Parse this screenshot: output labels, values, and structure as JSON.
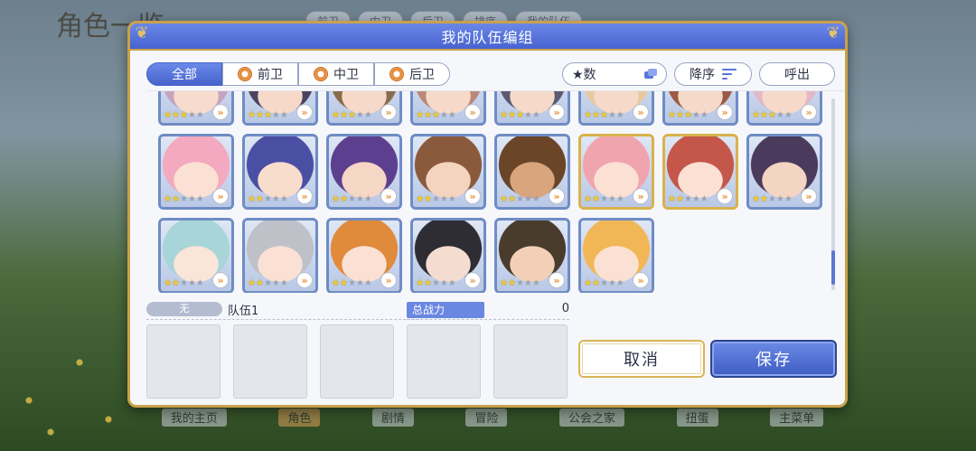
{
  "background": {
    "screen_title": "角色一览",
    "tabs": [
      "前卫",
      "中卫",
      "后卫",
      "排序",
      "我的队伍"
    ],
    "bottom_nav": [
      {
        "label": "我的主页",
        "active": false
      },
      {
        "label": "角色",
        "active": true
      },
      {
        "label": "剧情",
        "active": false
      },
      {
        "label": "冒险",
        "active": false
      },
      {
        "label": "公会之家",
        "active": false
      },
      {
        "label": "扭蛋",
        "active": false
      },
      {
        "label": "主菜单",
        "active": false
      }
    ]
  },
  "dialog": {
    "title": "我的队伍编组"
  },
  "filters": {
    "all": "全部",
    "front": "前卫",
    "middle": "中卫",
    "back": "后卫",
    "active": "全部"
  },
  "sort": {
    "key_label": "★数",
    "order_label": "降序",
    "call_out_label": "呼出"
  },
  "party": {
    "tag": "无",
    "name": "队伍1",
    "power_label": "总战力",
    "power_value": "0",
    "slots": 5
  },
  "buttons": {
    "cancel": "取消",
    "save": "保存"
  },
  "roster": [
    {
      "stars": 3,
      "badge": "»",
      "frame": "blue",
      "hair": "#c7a3bd",
      "skin": "#f7dccd"
    },
    {
      "stars": 3,
      "badge": "»",
      "frame": "blue",
      "hair": "#4a4461",
      "skin": "#f6d9c8"
    },
    {
      "stars": 3,
      "badge": "»",
      "frame": "blue",
      "hair": "#8a6b4a",
      "skin": "#f6d9c8"
    },
    {
      "stars": 3,
      "badge": "»",
      "frame": "blue",
      "hair": "#b98978",
      "skin": "#f6d9c8"
    },
    {
      "stars": 3,
      "badge": "»",
      "frame": "blue",
      "hair": "#5c5a72",
      "skin": "#f6d9c8"
    },
    {
      "stars": 3,
      "badge": "»",
      "frame": "blue",
      "hair": "#e7c9a1",
      "skin": "#f6d9c8"
    },
    {
      "stars": 3,
      "badge": "»",
      "frame": "blue",
      "hair": "#9c5a45",
      "skin": "#f6d9c8"
    },
    {
      "stars": 3,
      "badge": "»",
      "frame": "blue",
      "hair": "#e3b7c5",
      "skin": "#f6d9c8"
    },
    {
      "stars": 2,
      "badge": "»",
      "frame": "blue",
      "hair": "#f3a9bf",
      "skin": "#fbe1d3"
    },
    {
      "stars": 2,
      "badge": "»",
      "frame": "blue",
      "hair": "#4b4fa3",
      "skin": "#f8dccc"
    },
    {
      "stars": 2,
      "badge": "»",
      "frame": "blue",
      "hair": "#5d3f8f",
      "skin": "#f6d6c4"
    },
    {
      "stars": 2,
      "badge": "»",
      "frame": "blue",
      "hair": "#8a5a3d",
      "skin": "#f5d4bf"
    },
    {
      "stars": 2,
      "badge": "»",
      "frame": "blue",
      "hair": "#6a4528",
      "skin": "#d9a57d"
    },
    {
      "stars": 2,
      "badge": "»",
      "frame": "gold",
      "hair": "#f0a5ae",
      "skin": "#fbe1d3"
    },
    {
      "stars": 2,
      "badge": "»",
      "frame": "gold",
      "hair": "#c4574a",
      "skin": "#fbe1d3"
    },
    {
      "stars": 2,
      "badge": "»",
      "frame": "blue",
      "hair": "#4a3a5c",
      "skin": "#f4d4c2"
    },
    {
      "stars": 2,
      "badge": "»",
      "frame": "blue",
      "hair": "#a8d6d8",
      "skin": "#fbe4d8"
    },
    {
      "stars": 2,
      "badge": "»",
      "frame": "blue",
      "hair": "#bfc1c8",
      "skin": "#fbe1d3"
    },
    {
      "stars": 2,
      "badge": "»",
      "frame": "blue",
      "hair": "#e08a3c",
      "skin": "#fbe1d3"
    },
    {
      "stars": 2,
      "badge": "»",
      "frame": "blue",
      "hair": "#2d2d33",
      "skin": "#f5dcd0"
    },
    {
      "stars": 2,
      "badge": "»",
      "frame": "blue",
      "hair": "#4a3c2c",
      "skin": "#f2d0b8"
    },
    {
      "stars": 2,
      "badge": "»",
      "frame": "blue",
      "hair": "#f1b757",
      "skin": "#fbe1d3"
    }
  ]
}
